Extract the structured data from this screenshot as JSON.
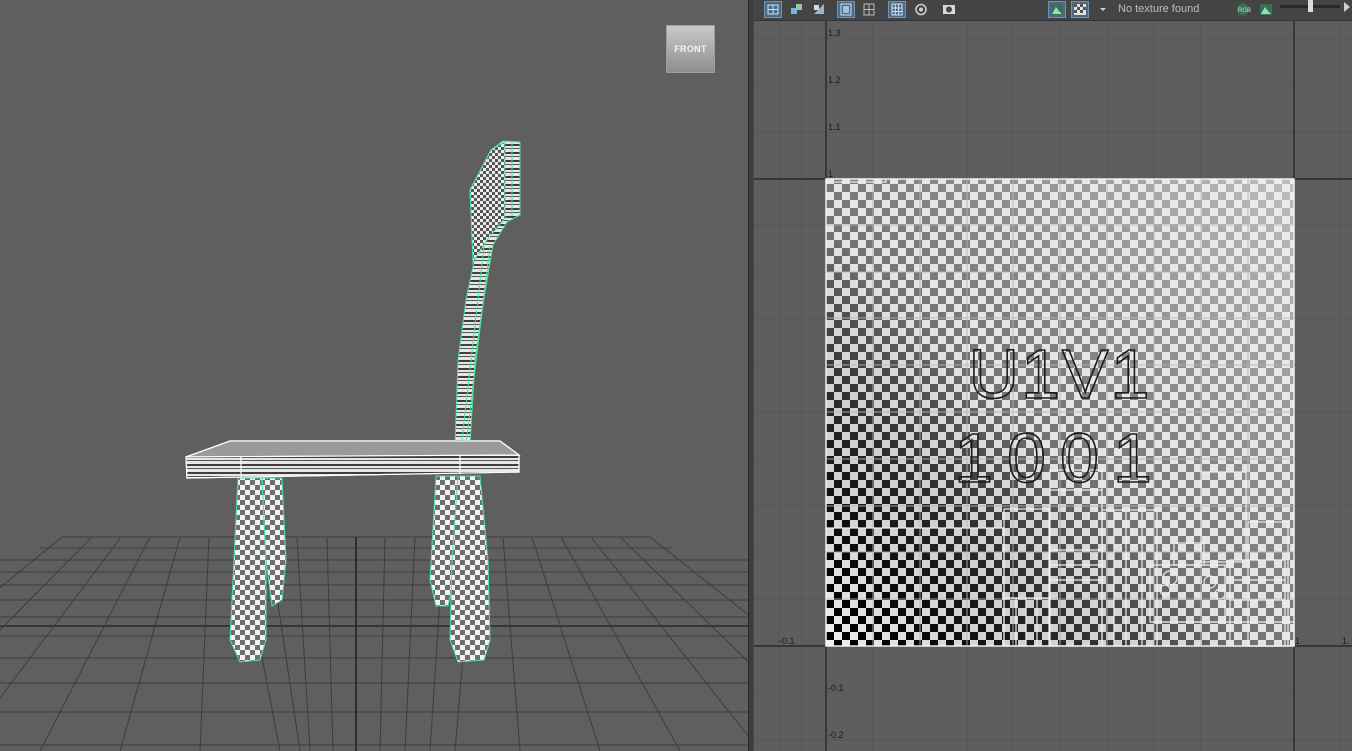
{
  "viewport": {
    "view_cube_label": "FRONT"
  },
  "uv_editor": {
    "toolbar": {
      "texture_status": "No texture found",
      "buttons": [
        {
          "icon": "grid-uv-icon",
          "active": true
        },
        {
          "icon": "shell-select-icon",
          "active": false
        },
        {
          "icon": "uv-shade-icon",
          "active": false
        },
        {
          "icon": "image-frame-icon",
          "active": true
        },
        {
          "icon": "grid-toggle-icon",
          "active": false
        },
        {
          "icon": "pixel-snap-icon",
          "active": true
        },
        {
          "icon": "distortion-icon",
          "active": false
        },
        {
          "icon": "camera-snapshot-icon",
          "active": false
        },
        {
          "icon": "display-image-icon",
          "active": true
        },
        {
          "icon": "checker-tile-icon",
          "active": true
        },
        {
          "icon": "rgb-channel-icon",
          "active": false
        },
        {
          "icon": "alpha-image-icon",
          "active": false
        }
      ]
    },
    "axis_labels": {
      "v_1_3": "1.3",
      "v_1_2": "1.2",
      "v_1_1": "1.1",
      "v_1": "1",
      "u_neg_0_1": "-0.1",
      "v_neg_0_1": "-0.1",
      "v_neg_0_2": "-0.2",
      "u_1": "1",
      "u_1_1": "1."
    },
    "tile_label": {
      "line1": "U1V1",
      "line2": "1001"
    }
  }
}
